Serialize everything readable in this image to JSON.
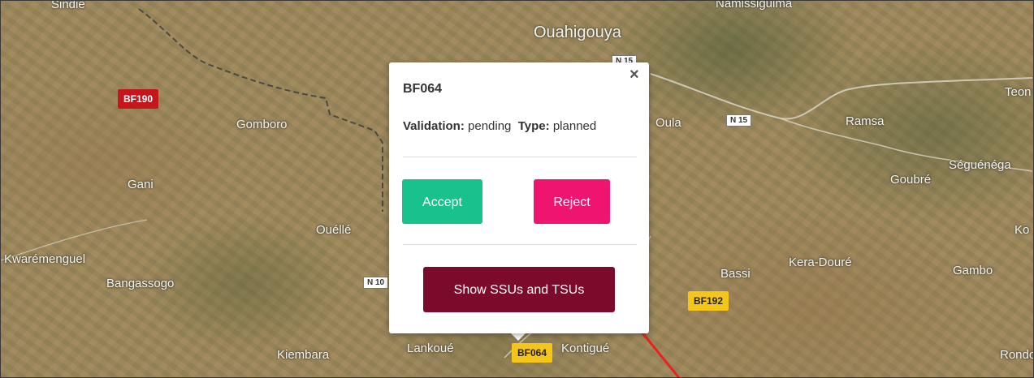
{
  "map": {
    "places": {
      "sindie": "Sindie",
      "ouahigouya": "Ouahigouya",
      "namissiguima": "Namissiguima",
      "gomboro": "Gomboro",
      "oula": "Oula",
      "ramsa": "Ramsa",
      "teon": "Teon",
      "gani": "Gani",
      "goubre": "Goubré",
      "seguenega": "Séguénéga",
      "quelle": "Ouéllé",
      "ko": "Ko",
      "kwaremenguel": "Kwarémenguel",
      "bangassogo": "Bangassogo",
      "bassi": "Bassi",
      "kera_doure": "Kera-Douré",
      "gambo": "Gambo",
      "kiembara": "Kiembara",
      "lankoue": "Lankoué",
      "kontigue": "Kontigué",
      "rondo": "Rondo"
    },
    "roads": {
      "n15_top": "N 15",
      "n15_right": "N 15",
      "n10": "N 10"
    },
    "markers": {
      "bf190": "BF190",
      "bf192": "BF192",
      "bf064": "BF064"
    },
    "colors": {
      "marker_pending": "#f5c518",
      "marker_rejected": "#c5161c"
    }
  },
  "popup": {
    "title": "BF064",
    "validation_label": "Validation:",
    "validation_value": "pending",
    "type_label": "Type:",
    "type_value": "planned",
    "close_symbol": "×",
    "accept_label": "Accept",
    "reject_label": "Reject",
    "show_label": "Show SSUs and TSUs",
    "colors": {
      "accept": "#19c28c",
      "reject": "#ef1470",
      "show": "#7c0a2a"
    }
  },
  "annotation": {
    "arrow_color": "#e8231e"
  }
}
